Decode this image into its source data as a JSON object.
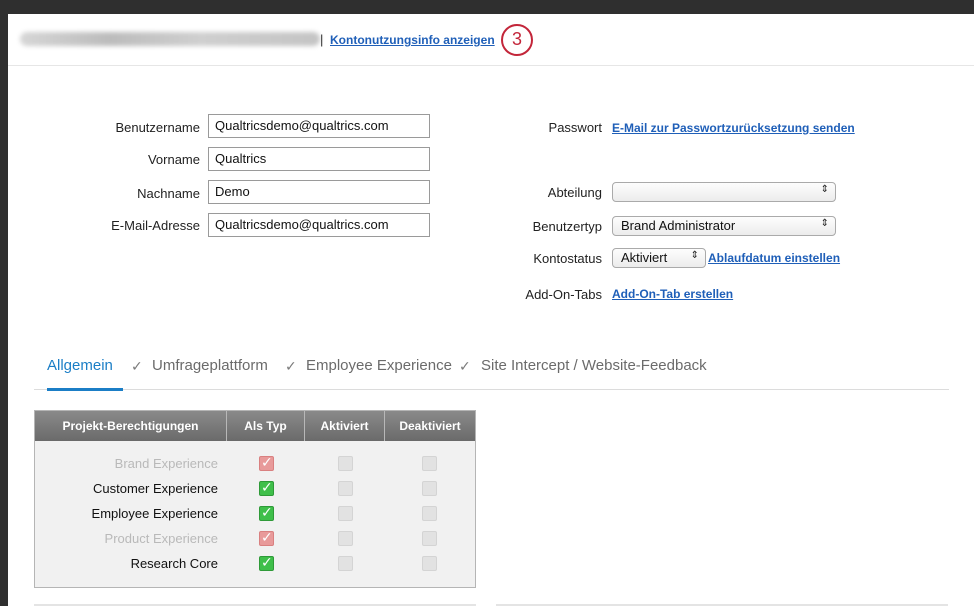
{
  "header": {
    "separator": "|",
    "account_info_link": "Kontonutzungsinfo anzeigen",
    "callout_number": "3"
  },
  "form_left": {
    "username_label": "Benutzername",
    "username_value": "Qualtricsdemo@qualtrics.com",
    "firstname_label": "Vorname",
    "firstname_value": "Qualtrics",
    "lastname_label": "Nachname",
    "lastname_value": "Demo",
    "email_label": "E-Mail-Adresse",
    "email_value": "Qualtricsdemo@qualtrics.com"
  },
  "form_right": {
    "password_label": "Passwort",
    "password_link": "E-Mail zur Passwortzurücksetzung senden",
    "department_label": "Abteilung",
    "department_value": "",
    "usertype_label": "Benutzertyp",
    "usertype_value": "Brand Administrator",
    "status_label": "Kontostatus",
    "status_value": "Aktiviert",
    "expiry_link": "Ablaufdatum einstellen",
    "addon_label": "Add-On-Tabs",
    "addon_link": "Add-On-Tab erstellen"
  },
  "tabs": [
    {
      "label": "Allgemein",
      "active": true
    },
    {
      "label": "Umfrageplattform",
      "active": false
    },
    {
      "label": "Employee Experience",
      "active": false
    },
    {
      "label": "Site Intercept / Website-Feedback",
      "active": false
    }
  ],
  "table": {
    "headers": [
      "Projekt-Berechtigungen",
      "Als Typ",
      "Aktiviert",
      "Deaktiviert"
    ],
    "rows": [
      {
        "name": "Brand Experience",
        "dimmed": true,
        "as_type": true
      },
      {
        "name": "Customer Experience",
        "dimmed": false,
        "as_type": true
      },
      {
        "name": "Employee Experience",
        "dimmed": false,
        "as_type": true
      },
      {
        "name": "Product Experience",
        "dimmed": true,
        "as_type": true
      },
      {
        "name": "Research Core",
        "dimmed": false,
        "as_type": true
      }
    ]
  },
  "colors": {
    "link": "#1f5fb8",
    "active_tab": "#1b7ec6",
    "callout": "#c3263a",
    "checked": "#3fbf4a",
    "checked_dimmed": "#e89a9a"
  }
}
